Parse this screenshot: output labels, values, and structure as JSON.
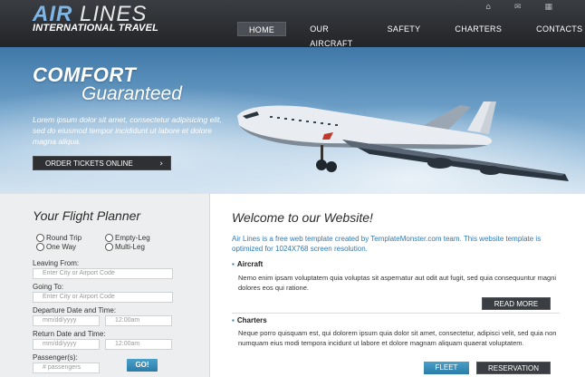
{
  "header": {
    "logo_air": "AIR",
    "logo_lines": " LINES",
    "logo_sub": "INTERNATIONAL TRAVEL",
    "nav": [
      "HOME",
      "OUR AIRCRAFT",
      "SAFETY",
      "CHARTERS",
      "CONTACTS"
    ],
    "icons": [
      "home-icon",
      "mail-icon",
      "sitemap-icon"
    ]
  },
  "hero": {
    "title": "COMFORT",
    "subtitle": "Guaranteed",
    "text": "Lorem ipsum dolor sit amet, consectetur adipisicing elit, sed do eiusmod tempor incididunt ut labore et dolore magna aliqua.",
    "order_button": "ORDER TICKETS ONLINE",
    "order_arrow": "›"
  },
  "planner": {
    "title": "Your Flight Planner",
    "radios": [
      "Round Trip",
      "Empty-Leg",
      "One Way",
      "Multi-Leg"
    ],
    "leaving_label": "Leaving From:",
    "leaving_placeholder": "Enter City or Airport Code",
    "going_label": "Going To:",
    "going_placeholder": "Enter City or Airport Code",
    "departure_label": "Departure Date and Time:",
    "return_label": "Return Date and Time:",
    "date_placeholder": "mm/dd/yyyy",
    "time_placeholder": "12:00am",
    "passengers_label": "Passenger(s):",
    "passengers_placeholder": "# passengers",
    "go_button": "GO!"
  },
  "main": {
    "welcome": "Welcome to our Website!",
    "intro": "Air Lines is a free web template created by TemplateMonster.com team. This website template is optimized for 1024X768 screen resolution.",
    "aircraft_title": "Aircraft",
    "aircraft_text": "Nemo enim ipsam voluptatem quia voluptas sit aspernatur aut odit aut fugit, sed quia consequuntur magni dolores eos qui ratione.",
    "read_more": "READ MORE",
    "charters_title": "Charters",
    "charters_text": "Neque porro quisquam est, qui dolorem ipsum quia dolor sit amet, consectetur, adipisci velit, sed quia non numquam eius modi tempora incidunt ut labore et dolore magnam aliquam quaerat voluptatem.",
    "fleet_button": "FLEET",
    "reservation_button": "RESERVATION"
  }
}
